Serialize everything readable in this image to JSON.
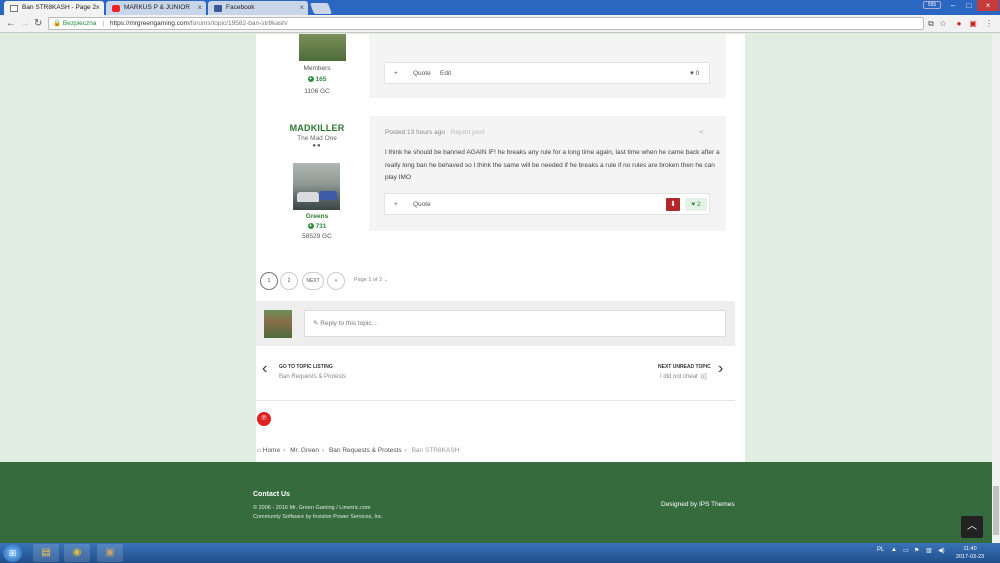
{
  "browser": {
    "tabs": [
      {
        "title": "Ban STR8KASH - Page 2",
        "icon": "page-icon",
        "active": true
      },
      {
        "title": "MARKUS P & JUNIOR",
        "icon": "youtube-icon",
        "active": false
      },
      {
        "title": "Facebook",
        "icon": "facebook-icon",
        "active": false
      }
    ],
    "user_button": "555",
    "secure_label": "Bezpieczna",
    "url_host": "https://mrgreengaming.com",
    "url_path": "/forums/topic/19582-ban-str8kash/"
  },
  "post1": {
    "group": "Members",
    "reputation": "165",
    "gc": "1106 GC",
    "actions": {
      "plus": "+",
      "quote": "Quote",
      "edit": "Edit",
      "likes": "0"
    }
  },
  "post2": {
    "author": "MADKILLER",
    "title": "The Mad One",
    "group": "Greens",
    "reputation": "731",
    "gc": "58529 GC",
    "posted": "Posted 13 hours ago",
    "report": "· Report post",
    "body": "I think he should be banned AGAIN IF! he breaks any rule for a long time again, last time when he came back after a really long ban he behaved so I think the same will be needed if he breaks a rule if no rules are broken then he can play IMO",
    "actions": {
      "plus": "+",
      "quote": "Quote",
      "likes": "2"
    }
  },
  "pagination": {
    "page1": "1",
    "page2": "2",
    "next": "NEXT",
    "last": "»",
    "page_of": "Page 1 of 2"
  },
  "reply": {
    "placeholder": "Reply to this topic..."
  },
  "topic_nav": {
    "prev_label": "GO TO TOPIC LISTING",
    "prev_sub": "Ban Requests & Protests",
    "next_label": "NEXT UNREAD TOPIC",
    "next_sub": "I did not cheat :((("
  },
  "breadcrumb": [
    "Home",
    "Mr. Green",
    "Ban Requests & Protests",
    "Ban STR8KASH"
  ],
  "footer": {
    "contact": "Contact Us",
    "copyright": "© 2006 - 2016 Mr. Green Gaming / Limetric.com",
    "software": "Community Software by Invision Power Services, Inc.",
    "designed": "Designed by IPS Themes"
  },
  "taskbar": {
    "lang": "PL",
    "time": "11:40",
    "date": "2017-03-23"
  },
  "colors": {
    "accent_green": "#2b7a2f",
    "footer_green": "#366b3e",
    "page_bg": "#dfeee0",
    "downvote_red": "#b1282c"
  }
}
